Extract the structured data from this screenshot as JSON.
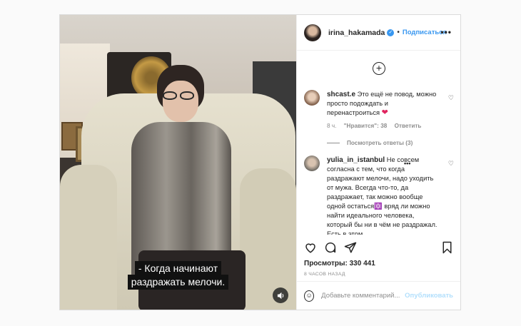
{
  "post": {
    "username": "irina_hakamada",
    "follow_label": "Подписаться",
    "separator": "•"
  },
  "video": {
    "subtitle_line1": "- Когда начинают",
    "subtitle_line2": "раздражать мелочи."
  },
  "comments": [
    {
      "user": "shcast.e",
      "text": "Это ещё не повод, можно просто подождать и перенастроиться",
      "time": "8 ч.",
      "likes": "\"Нравится\": 38",
      "reply": "Ответить",
      "view_replies": "Посмотреть ответы (3)"
    },
    {
      "user": "yulia_in_istanbul",
      "text": "Не совсем согласна с тем, что когда раздражают мелочи, надо уходить от мужа. Всегда что-то, да раздражает, так можно вообще одной остаться🔯 вряд ли можно найти идеального человека, который бы ни в чём не раздражал. Есть в этом"
    }
  ],
  "stats": {
    "views": "Просмотры: 330 441",
    "time_ago": "8 ЧАСОВ НАЗАД"
  },
  "add_comment": {
    "placeholder": "Добавьте комментарий...",
    "publish_label": "Опубликовать"
  },
  "icons": {
    "more": "more-options-icon",
    "add": "plus-circle-icon",
    "like": "heart-icon",
    "comment": "comment-icon",
    "share": "share-icon",
    "save": "bookmark-icon",
    "sound": "speaker-icon",
    "emoji": "emoji-icon",
    "verified": "verified-badge-icon"
  },
  "colors": {
    "accent": "#3897f0",
    "publish_disabled": "#b2dffc",
    "heart_red": "#e0245e"
  }
}
